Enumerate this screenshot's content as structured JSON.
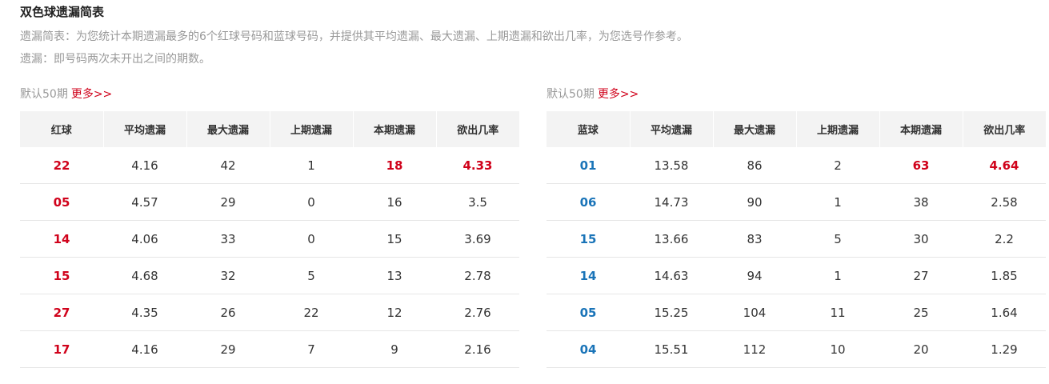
{
  "page": {
    "title": "双色球遗漏简表",
    "desc1": "遗漏简表：为您统计本期遗漏最多的6个红球号码和蓝球号码，并提供其平均遗漏、最大遗漏、上期遗漏和欲出几率，为您选号作参考。",
    "desc2": "遗漏：即号码两次未开出之间的期数。"
  },
  "red_table": {
    "default_label": "默认50期",
    "more_label": "更多>>",
    "headers": [
      "红球",
      "平均遗漏",
      "最大遗漏",
      "上期遗漏",
      "本期遗漏",
      "欲出几率"
    ],
    "rows": [
      [
        "22",
        "4.16",
        "42",
        "1",
        "18",
        "4.33"
      ],
      [
        "05",
        "4.57",
        "29",
        "0",
        "16",
        "3.5"
      ],
      [
        "14",
        "4.06",
        "33",
        "0",
        "15",
        "3.69"
      ],
      [
        "15",
        "4.68",
        "32",
        "5",
        "13",
        "2.78"
      ],
      [
        "27",
        "4.35",
        "26",
        "22",
        "12",
        "2.76"
      ],
      [
        "17",
        "4.16",
        "29",
        "7",
        "9",
        "2.16"
      ]
    ]
  },
  "blue_table": {
    "default_label": "默认50期",
    "more_label": "更多>>",
    "headers": [
      "蓝球",
      "平均遗漏",
      "最大遗漏",
      "上期遗漏",
      "本期遗漏",
      "欲出几率"
    ],
    "rows": [
      [
        "01",
        "13.58",
        "86",
        "2",
        "63",
        "4.64"
      ],
      [
        "06",
        "14.73",
        "90",
        "1",
        "38",
        "2.58"
      ],
      [
        "15",
        "13.66",
        "83",
        "5",
        "30",
        "2.2"
      ],
      [
        "14",
        "14.63",
        "94",
        "1",
        "27",
        "1.85"
      ],
      [
        "05",
        "15.25",
        "104",
        "11",
        "25",
        "1.64"
      ],
      [
        "04",
        "15.51",
        "112",
        "10",
        "20",
        "1.29"
      ]
    ]
  },
  "colors": {
    "red": "#d0021b",
    "blue": "#1a74b8",
    "header_bg": "#f3f3f3",
    "muted": "#999999"
  }
}
